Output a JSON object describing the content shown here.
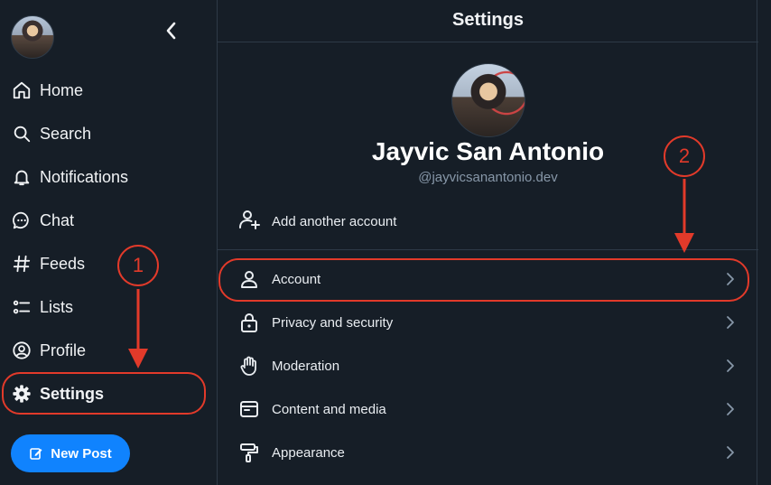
{
  "sidebar": {
    "items": [
      {
        "label": "Home",
        "icon": "home-icon"
      },
      {
        "label": "Search",
        "icon": "search-icon"
      },
      {
        "label": "Notifications",
        "icon": "bell-icon"
      },
      {
        "label": "Chat",
        "icon": "chat-bubble-icon"
      },
      {
        "label": "Feeds",
        "icon": "hash-icon"
      },
      {
        "label": "Lists",
        "icon": "list-icon"
      },
      {
        "label": "Profile",
        "icon": "user-circle-icon"
      },
      {
        "label": "Settings",
        "icon": "gear-icon"
      }
    ],
    "new_post_label": "New Post"
  },
  "header": {
    "title": "Settings"
  },
  "profile": {
    "name": "Jayvic San Antonio",
    "handle": "@jayvicsanantonio.dev"
  },
  "add_account_label": "Add another account",
  "settings_rows": [
    {
      "label": "Account",
      "icon": "user-icon"
    },
    {
      "label": "Privacy and security",
      "icon": "lock-icon"
    },
    {
      "label": "Moderation",
      "icon": "hand-icon"
    },
    {
      "label": "Content and media",
      "icon": "window-icon"
    },
    {
      "label": "Appearance",
      "icon": "paint-roller-icon"
    }
  ],
  "annotations": {
    "step1": "1",
    "step2": "2",
    "color": "#e23a2a"
  },
  "colors": {
    "background": "#161e27",
    "accent": "#1083fe",
    "border": "#2e3a47",
    "muted": "#8797a8"
  }
}
